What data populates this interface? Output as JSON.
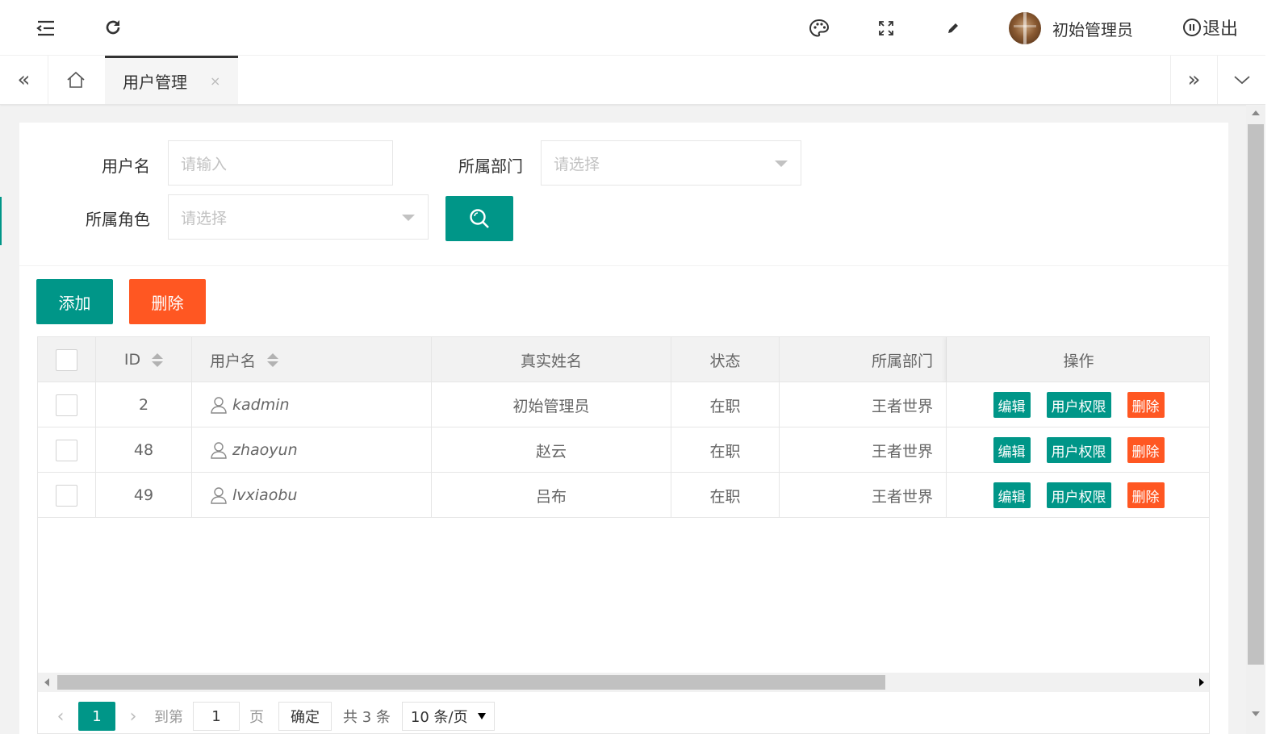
{
  "header": {
    "user_name": "初始管理员",
    "logout_label": "退出"
  },
  "tabs": {
    "active_label": "用户管理",
    "close_glyph": "×"
  },
  "search_form": {
    "username_label": "用户名",
    "username_placeholder": "请输入",
    "dept_label": "所属部门",
    "dept_placeholder": "请选择",
    "role_label": "所属角色",
    "role_placeholder": "请选择"
  },
  "toolbar": {
    "add_label": "添加",
    "delete_label": "删除"
  },
  "table": {
    "columns": {
      "id": "ID",
      "username": "用户名",
      "realname": "真实姓名",
      "status": "状态",
      "dept": "所属部门",
      "ops": "操作"
    },
    "rows": [
      {
        "id": "2",
        "username": "kadmin",
        "realname": "初始管理员",
        "status": "在职",
        "dept": "王者世界"
      },
      {
        "id": "48",
        "username": "zhaoyun",
        "realname": "赵云",
        "status": "在职",
        "dept": "王者世界"
      },
      {
        "id": "49",
        "username": "lvxiaobu",
        "realname": "吕布",
        "status": "在职",
        "dept": "王者世界"
      }
    ],
    "row_actions": {
      "edit": "编辑",
      "permission": "用户权限",
      "delete": "删除"
    }
  },
  "pagination": {
    "current_page": "1",
    "goto_label": "到第",
    "goto_value": "1",
    "page_unit": "页",
    "confirm_label": "确定",
    "total_text": "共 3 条",
    "page_size": "10 条/页"
  },
  "colors": {
    "primary": "#009688",
    "danger": "#ff5722"
  }
}
